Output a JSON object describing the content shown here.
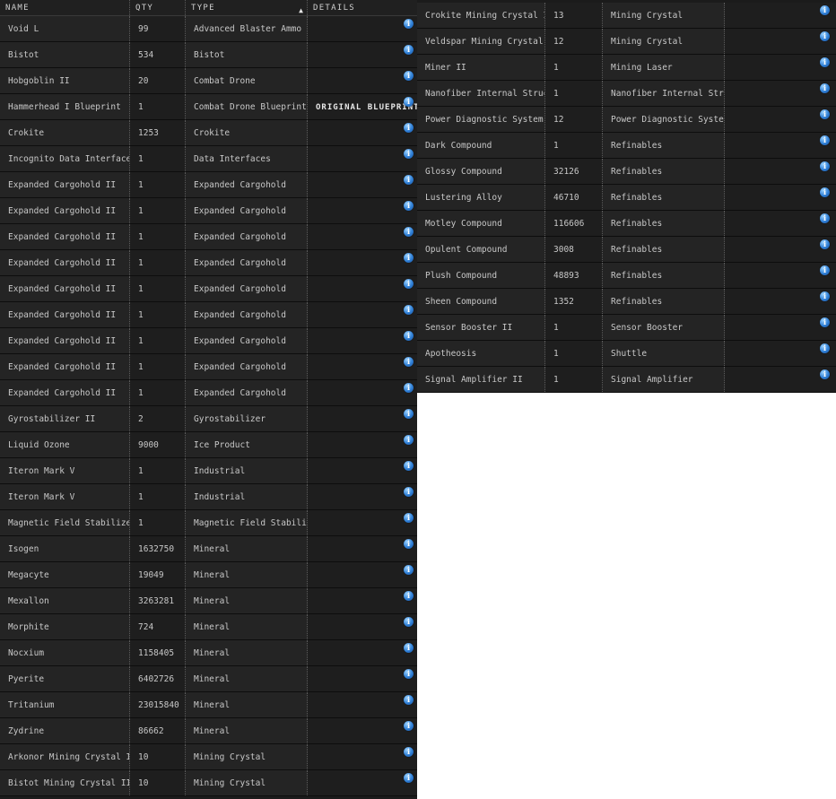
{
  "left_panel": {
    "columns": {
      "name": "NAME",
      "qty": "QTY",
      "type": "TYPE",
      "details": "DETAILS"
    },
    "sort_indicator": "▲",
    "info_glyph": "i",
    "rows": [
      {
        "name": "Void L",
        "qty": "99",
        "type": "Advanced Blaster Ammo",
        "details": ""
      },
      {
        "name": "Bistot",
        "qty": "534",
        "type": "Bistot",
        "details": ""
      },
      {
        "name": "Hobgoblin II",
        "qty": "20",
        "type": "Combat Drone",
        "details": ""
      },
      {
        "name": "Hammerhead I Blueprint",
        "qty": "1",
        "type": "Combat Drone Blueprint",
        "details": "ORIGINAL BLUEPRINT"
      },
      {
        "name": "Crokite",
        "qty": "1253",
        "type": "Crokite",
        "details": ""
      },
      {
        "name": "Incognito Data Interface",
        "qty": "1",
        "type": "Data Interfaces",
        "details": ""
      },
      {
        "name": "Expanded Cargohold II",
        "qty": "1",
        "type": "Expanded Cargohold",
        "details": ""
      },
      {
        "name": "Expanded Cargohold II",
        "qty": "1",
        "type": "Expanded Cargohold",
        "details": ""
      },
      {
        "name": "Expanded Cargohold II",
        "qty": "1",
        "type": "Expanded Cargohold",
        "details": ""
      },
      {
        "name": "Expanded Cargohold II",
        "qty": "1",
        "type": "Expanded Cargohold",
        "details": ""
      },
      {
        "name": "Expanded Cargohold II",
        "qty": "1",
        "type": "Expanded Cargohold",
        "details": ""
      },
      {
        "name": "Expanded Cargohold II",
        "qty": "1",
        "type": "Expanded Cargohold",
        "details": ""
      },
      {
        "name": "Expanded Cargohold II",
        "qty": "1",
        "type": "Expanded Cargohold",
        "details": ""
      },
      {
        "name": "Expanded Cargohold II",
        "qty": "1",
        "type": "Expanded Cargohold",
        "details": ""
      },
      {
        "name": "Expanded Cargohold II",
        "qty": "1",
        "type": "Expanded Cargohold",
        "details": ""
      },
      {
        "name": "Gyrostabilizer II",
        "qty": "2",
        "type": "Gyrostabilizer",
        "details": ""
      },
      {
        "name": "Liquid Ozone",
        "qty": "9000",
        "type": "Ice Product",
        "details": ""
      },
      {
        "name": "Iteron Mark V",
        "qty": "1",
        "type": "Industrial",
        "details": ""
      },
      {
        "name": "Iteron Mark V",
        "qty": "1",
        "type": "Industrial",
        "details": ""
      },
      {
        "name": "Magnetic Field Stabilizer II",
        "qty": "1",
        "type": "Magnetic Field Stabilizer",
        "details": ""
      },
      {
        "name": "Isogen",
        "qty": "1632750",
        "type": "Mineral",
        "details": ""
      },
      {
        "name": "Megacyte",
        "qty": "19049",
        "type": "Mineral",
        "details": ""
      },
      {
        "name": "Mexallon",
        "qty": "3263281",
        "type": "Mineral",
        "details": ""
      },
      {
        "name": "Morphite",
        "qty": "724",
        "type": "Mineral",
        "details": ""
      },
      {
        "name": "Nocxium",
        "qty": "1158405",
        "type": "Mineral",
        "details": ""
      },
      {
        "name": "Pyerite",
        "qty": "6402726",
        "type": "Mineral",
        "details": ""
      },
      {
        "name": "Tritanium",
        "qty": "23015840",
        "type": "Mineral",
        "details": ""
      },
      {
        "name": "Zydrine",
        "qty": "86662",
        "type": "Mineral",
        "details": ""
      },
      {
        "name": "Arkonor Mining Crystal II",
        "qty": "10",
        "type": "Mining Crystal",
        "details": ""
      },
      {
        "name": "Bistot Mining Crystal II",
        "qty": "10",
        "type": "Mining Crystal",
        "details": ""
      }
    ]
  },
  "right_panel": {
    "info_glyph": "i",
    "rows": [
      {
        "name": "Crokite Mining Crystal II",
        "qty": "13",
        "type": "Mining Crystal",
        "details": ""
      },
      {
        "name": "Veldspar Mining Crystal II",
        "qty": "12",
        "type": "Mining Crystal",
        "details": ""
      },
      {
        "name": "Miner II",
        "qty": "1",
        "type": "Mining Laser",
        "details": ""
      },
      {
        "name": "Nanofiber Internal Structure II",
        "qty": "1",
        "type": "Nanofiber Internal Structure",
        "details": ""
      },
      {
        "name": "Power Diagnostic System II",
        "qty": "12",
        "type": "Power Diagnostic System",
        "details": ""
      },
      {
        "name": "Dark Compound",
        "qty": "1",
        "type": "Refinables",
        "details": ""
      },
      {
        "name": "Glossy Compound",
        "qty": "32126",
        "type": "Refinables",
        "details": ""
      },
      {
        "name": "Lustering Alloy",
        "qty": "46710",
        "type": "Refinables",
        "details": ""
      },
      {
        "name": "Motley Compound",
        "qty": "116606",
        "type": "Refinables",
        "details": ""
      },
      {
        "name": "Opulent Compound",
        "qty": "3008",
        "type": "Refinables",
        "details": ""
      },
      {
        "name": "Plush Compound",
        "qty": "48893",
        "type": "Refinables",
        "details": ""
      },
      {
        "name": "Sheen Compound",
        "qty": "1352",
        "type": "Refinables",
        "details": ""
      },
      {
        "name": "Sensor Booster II",
        "qty": "1",
        "type": "Sensor Booster",
        "details": ""
      },
      {
        "name": "Apotheosis",
        "qty": "1",
        "type": "Shuttle",
        "details": ""
      },
      {
        "name": "Signal Amplifier II",
        "qty": "1",
        "type": "Signal Amplifier",
        "details": ""
      }
    ]
  },
  "colors": {
    "background": "#1b1b1b",
    "text": "#c8c8c8",
    "info_icon": "#2f7fd6"
  }
}
